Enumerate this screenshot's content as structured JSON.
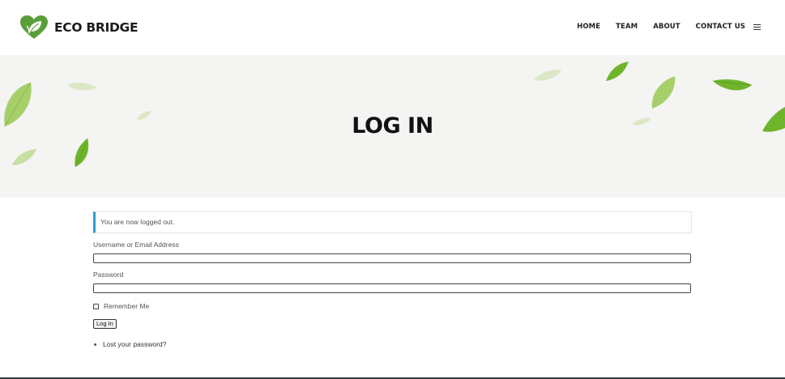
{
  "brand": {
    "name": "ECO BRIDGE",
    "icon": "heart-leaf-logo-icon",
    "color": "#5a9e3a"
  },
  "nav": {
    "items": [
      {
        "label": "HOME"
      },
      {
        "label": "TEAM"
      },
      {
        "label": "ABOUT"
      },
      {
        "label": "CONTACT US"
      }
    ],
    "menu_icon": "hamburger-menu-icon"
  },
  "hero": {
    "title": "LOG IN",
    "background": "#f4f4f2"
  },
  "form": {
    "notice": "You are now logged out.",
    "username_label": "Username or Email Address",
    "username_value": "",
    "password_label": "Password",
    "password_value": "",
    "remember_label": "Remember Me",
    "remember_checked": false,
    "submit_label": "Log In",
    "lost_password": "Lost your password?"
  },
  "colors": {
    "notice_accent": "#2b9fcf",
    "leaf_dark": "#6fb52c",
    "leaf_light": "#b8d98a"
  }
}
